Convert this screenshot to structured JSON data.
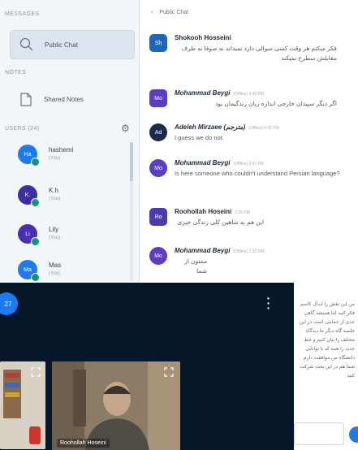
{
  "sidebar": {
    "messages_title": "MESSAGES",
    "public_chat_label": "Public Chat",
    "notes_title": "NOTES",
    "shared_notes_label": "Shared Notes",
    "users_title": "USERS (24)",
    "users": [
      {
        "initials": "Ha",
        "name": "hashemi",
        "role": "(You)",
        "color": "#1c7bf0"
      },
      {
        "initials": "K.",
        "name": "K.h",
        "role": "(You)",
        "color": "#3b2fa3"
      },
      {
        "initials": "Li",
        "name": "Lily",
        "role": "(You)",
        "color": "#4a2fb5"
      },
      {
        "initials": "Ma",
        "name": "Mas",
        "role": "(You)",
        "color": "#1c7bf0"
      }
    ]
  },
  "chat": {
    "back_glyph": "‹",
    "title": "Public Chat",
    "messages": [
      {
        "initials": "Sh",
        "avatar_color": "#1c65b8",
        "name": "Shokooh Hosseini",
        "meta": "",
        "text": "فکر میکنم هر وقت کسی سوالی دارد نمیداند نه صوفا نه طرف مقابلش سطرح نمیکند"
      },
      {
        "initials": "Mo",
        "avatar_color": "#5a3cc5",
        "name": "Mohammad Beygi",
        "meta": "(Offline) 9:40 PM",
        "text": "اگر دیگر سپیدان خارجی اندازه زبان زندگیمان بود"
      },
      {
        "initials": "Ad",
        "avatar_color": "#1b2a4f",
        "name": "Adeleh Mirzaee (مترجم)",
        "meta": "(Offline) 9:41 PM",
        "text": "I guess we do not."
      },
      {
        "initials": "Mo",
        "avatar_color": "#5a3cc5",
        "name": "Mohammad Beygi",
        "meta": "(Offline) 9:41 PM",
        "text": "Is here someone who couldn't understand Persian language?"
      },
      {
        "initials": "Ro",
        "avatar_color": "#4a3bb0",
        "name": "Roohollah Hoseini",
        "meta": "7:20 PM",
        "text": "این هم به شاهین کلی زندگی خیزی"
      },
      {
        "initials": "Mo",
        "avatar_color": "#5a3cc5",
        "name": "Mohammad Beygi",
        "meta": "(Offline) 7:32 PM",
        "text": "ممنون از شما"
      }
    ]
  },
  "video": {
    "badge": "27",
    "tile_name": "Roohollah Hoseini"
  },
  "notes_text": "من این نقش را ایدآل کاسم فکر کنید اما همیشه گاهی جدی از حمایتی است در این جلسه گاه دیگر ما دیدگاه مختلف را بیان کنیم و خط جدید را همه که با توانایی دانشگاه من موافقت دارم شما هم در این بحث شرکت کنید"
}
